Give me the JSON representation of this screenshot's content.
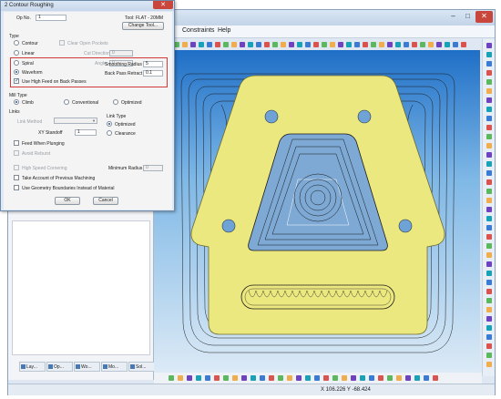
{
  "app": {
    "menu": {
      "constraints": "Constraints",
      "help": "Help"
    },
    "window_buttons": {
      "minimize": "–",
      "maximize": "□",
      "close": "✕"
    },
    "left_tabs": [
      "Lay...",
      "Op...",
      "Wo...",
      "Mo...",
      "Sol..."
    ],
    "status": {
      "coords": "X 106.226   Y -68.424"
    },
    "colors": {
      "viewport_top": "#1f6fc7",
      "viewport_bottom": "#dceaf6",
      "part_fill": "#ece880",
      "toolpath": "#1a1a1a"
    }
  },
  "dialog": {
    "title": "2 Contour Roughing",
    "close": "✕",
    "op_no_label": "Op No.",
    "op_no_value": "1",
    "tool_label": "Tool: FLAT - 20MM",
    "change_tool": "Change Tool...",
    "type_label": "Type",
    "type_options": {
      "contour": "Contour",
      "linear": "Linear",
      "spiral": "Spiral",
      "waveform": "Waveform",
      "selected": "Waveform"
    },
    "clear_open_pockets": "Clear Open Pockets",
    "cut_direction_label": "Cut Direction",
    "cut_direction_value": "0",
    "angle_label": "Angle",
    "angle_value": "0",
    "smoothing_radius_label": "Smoothing Radius",
    "smoothing_radius_value": "5",
    "back_pass_retract_label": "Back Pass Retract",
    "back_pass_retract_value": "0.1",
    "use_high_feed": "Use High Feed on Back Passes",
    "use_high_feed_checked": true,
    "mill_type_label": "Mill Type",
    "mill_type_options": {
      "climb": "Climb",
      "conventional": "Conventional",
      "optimized": "Optimized",
      "selected": "Climb"
    },
    "links_label": "Links",
    "link_method_label": "Link Method",
    "link_type_label": "Link Type",
    "link_type_options": {
      "optimized": "Optimized",
      "clearance": "Clearance",
      "selected": "Optimized"
    },
    "xy_standoff_label": "XY Standoff",
    "xy_standoff_value": "1",
    "feed_when_plunging": "Feed When Plunging",
    "avoid_reburst": "Avoid Reburst",
    "high_speed_cornering": "High Speed Cornering",
    "minimum_radius_label": "Minimum Radius",
    "minimum_radius_value": "0",
    "take_account_previous": "Take Account of Previous Machining",
    "use_geometry_boundaries": "Use Geometry Boundaries Instead of Material",
    "ok": "OK",
    "cancel": "Cancel"
  }
}
